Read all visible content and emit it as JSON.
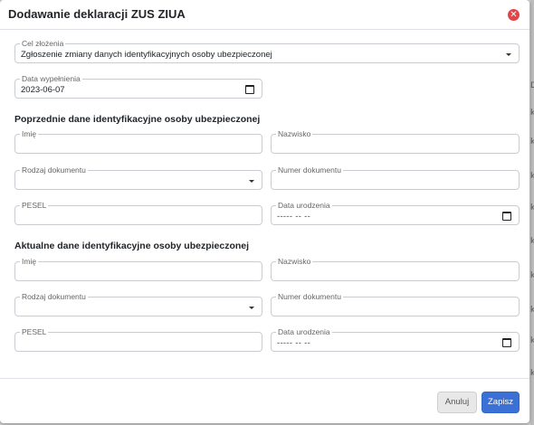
{
  "modal": {
    "title": "Dodawanie deklaracji ZUS ZIUA"
  },
  "form": {
    "cel_zlozenia": {
      "label": "Cel złożenia",
      "value": "Zgłoszenie zmiany danych identyfikacyjnych osoby ubezpieczonej"
    },
    "data_wypelnienia": {
      "label": "Data wypełnienia",
      "value": "2023-06-07"
    }
  },
  "previous": {
    "heading": "Poprzednie dane identyfikacyjne osoby ubezpieczonej",
    "imie_label": "Imię",
    "nazwisko_label": "Nazwisko",
    "rodzaj_label": "Rodzaj dokumentu",
    "numer_label": "Numer dokumentu",
    "pesel_label": "PESEL",
    "data_urodzenia_label": "Data urodzenia",
    "data_urodzenia_placeholder": "----- -- --"
  },
  "current": {
    "heading": "Aktualne dane identyfikacyjne osoby ubezpieczonej",
    "imie_label": "Imię",
    "nazwisko_label": "Nazwisko",
    "rodzaj_label": "Rodzaj dokumentu",
    "numer_label": "Numer dokumentu",
    "pesel_label": "PESEL",
    "data_urodzenia_label": "Data urodzenia",
    "data_urodzenia_placeholder": "----- -- --"
  },
  "footer": {
    "cancel_label": "Anuluj",
    "save_label": "Zapisz"
  },
  "background": {
    "marks": [
      "D",
      "k",
      "k",
      "k",
      "k",
      "k",
      "k",
      "k",
      "k",
      "k"
    ]
  },
  "colors": {
    "primary": "#3b71d6",
    "danger": "#e0454b",
    "border": "#c9cdd2"
  },
  "icons": {
    "close": "close-circle-icon",
    "select": "chevron-down-icon",
    "date": "calendar-icon"
  }
}
